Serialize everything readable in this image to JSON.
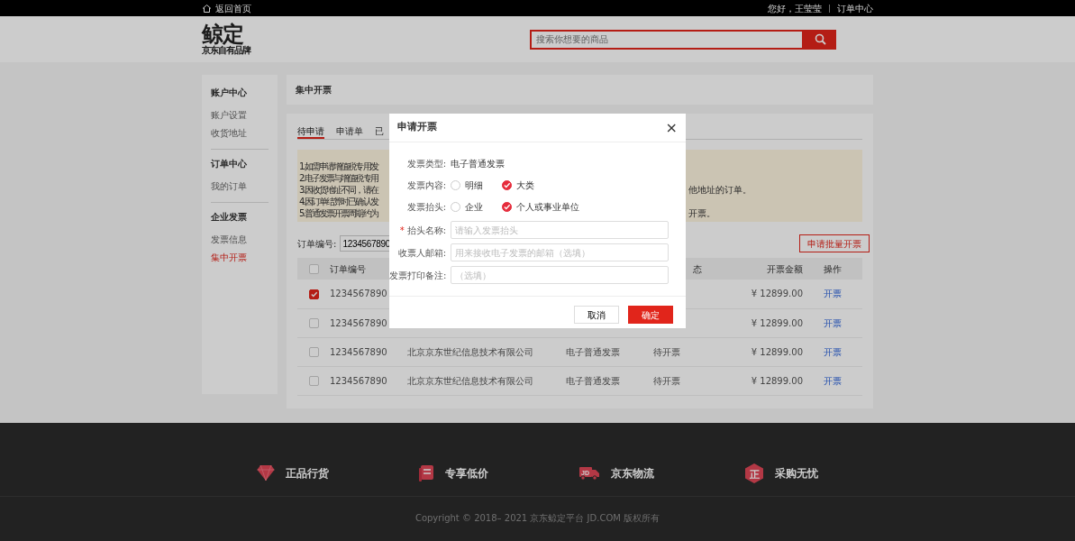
{
  "top_bar": {
    "home_link": "返回首页",
    "greeting": "您好，王莹莹",
    "order_center": "订单中心"
  },
  "header": {
    "logo_text": "鲸定",
    "logo_subtitle": "京东自有品牌",
    "search": {
      "placeholder": "搜索你想要的商品"
    }
  },
  "sidebar": {
    "sections": [
      {
        "title": "账户中心",
        "items": [
          {
            "label": "账户设置",
            "selected": false
          },
          {
            "label": "收货地址",
            "selected": false
          }
        ]
      },
      {
        "title": "订单中心",
        "items": [
          {
            "label": "我的订单",
            "selected": false
          }
        ]
      },
      {
        "title": "企业发票",
        "items": [
          {
            "label": "发票信息",
            "selected": false
          },
          {
            "label": "集中开票",
            "selected": true
          }
        ]
      }
    ]
  },
  "page_title": "集中开票",
  "tabs": [
    {
      "label": "待申请",
      "selected": true
    },
    {
      "label": "申请单",
      "selected": false
    },
    {
      "label": "已",
      "selected": false
    }
  ],
  "notice": {
    "lines": [
      {
        "start": "1.如需申请增值税专用发"
      },
      {
        "start": "2.电子发票与增值税专用"
      },
      {
        "start": "3.因收货地址不同，请在",
        "end": "他地址的订单。"
      },
      {
        "start": "4.因订单结算时已确认发"
      },
      {
        "start": "5.普通发票开票周期约为",
        "end": "开票。"
      }
    ]
  },
  "filter": {
    "label": "订单编号:",
    "value": "1234567890"
  },
  "batch_button": "申请批量开票",
  "table": {
    "header_checked": false,
    "columns": [
      "订单编号",
      "态",
      "开票金额",
      "操作"
    ],
    "rows": [
      {
        "checked": true,
        "order_no": "1234567890",
        "amount": "¥ 12899.00",
        "action": "开票"
      },
      {
        "checked": false,
        "order_no": "1234567890",
        "amount": "¥ 12899.00",
        "action": "开票"
      },
      {
        "checked": false,
        "order_no": "1234567890",
        "company": "北京京东世纪信息技术有限公司",
        "type": "电子普通发票",
        "status": "待开票",
        "amount": "¥ 12899.00",
        "action": "开票"
      },
      {
        "checked": false,
        "order_no": "1234567890",
        "company": "北京京东世纪信息技术有限公司",
        "type": "电子普通发票",
        "status": "待开票",
        "amount": "¥ 12899.00",
        "action": "开票"
      }
    ]
  },
  "modal": {
    "title": "申请开票",
    "close": "×",
    "required_mark": "*",
    "fields": [
      {
        "kind": "text",
        "label": "发票类型:",
        "value": "电子普通发票"
      },
      {
        "kind": "radio",
        "label": "发票内容:",
        "options": [
          {
            "label": "明细",
            "selected": false
          },
          {
            "label": "大类",
            "selected": true
          }
        ]
      },
      {
        "kind": "radio",
        "label": "发票抬头:",
        "options": [
          {
            "label": "企业",
            "selected": false
          },
          {
            "label": "个人或事业单位",
            "selected": true
          }
        ]
      },
      {
        "kind": "input",
        "label": "抬头名称:",
        "required": true,
        "placeholder": "请输入发票抬头"
      },
      {
        "kind": "input",
        "label": "收票人邮箱:",
        "required": false,
        "placeholder": "用来接收电子发票的邮箱（选填）"
      },
      {
        "kind": "input",
        "label": "发票打印备注:",
        "required": false,
        "placeholder": "（选填）"
      }
    ],
    "cancel": "取消",
    "confirm": "确定"
  },
  "footer": {
    "features": [
      {
        "kind": "diamond",
        "label": "正品行货"
      },
      {
        "kind": "document",
        "label": "专享低价"
      },
      {
        "kind": "truck",
        "label": "京东物流",
        "icon_text": "JD"
      },
      {
        "kind": "hexagon",
        "label": "采购无忧",
        "icon_text": "正"
      }
    ],
    "copyright": "Copyright © 2018– 2021 京东鲸定平台 JD.COM 版权所有"
  }
}
